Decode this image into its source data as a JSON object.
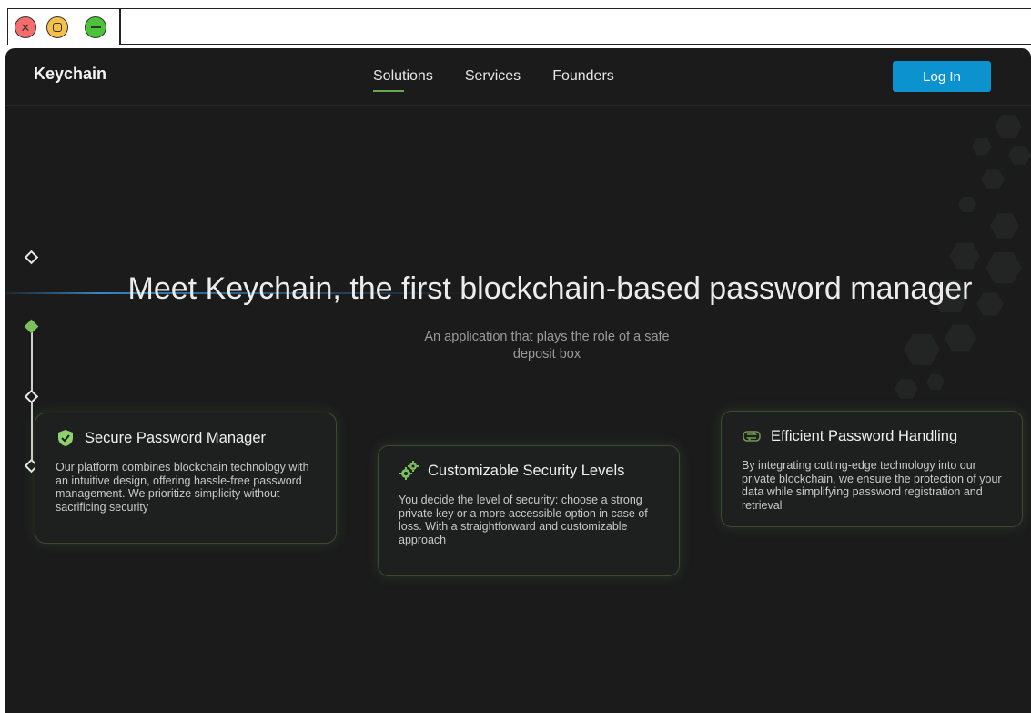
{
  "app": {
    "logo": "Keychain"
  },
  "nav": {
    "items": [
      "Solutions",
      "Services",
      "Founders"
    ]
  },
  "header": {
    "login_label": "Log In"
  },
  "hero": {
    "title": "Meet Keychain, the first blockchain-based password manager",
    "subtitle": "An application that plays the role of a safe deposit box"
  },
  "cards": [
    {
      "title": "Secure Password Manager",
      "body": "Our platform combines blockchain technology with an intuitive design, offering hassle-free password management. We prioritize simplicity without sacrificing security",
      "icon": "shield-check-icon"
    },
    {
      "title": "Customizable Security Levels",
      "body": "You decide the level of security: choose a strong private key or a more accessible option in case of loss. With a straightforward and customizable approach",
      "icon": "gears-icon"
    },
    {
      "title": "Efficient Password Handling",
      "body": "By integrating cutting-edge technology into our private blockchain, we ensure the protection of your data while simplifying password registration and retrieval",
      "icon": "exchange-icon"
    }
  ],
  "colors": {
    "accent_blue": "#0c93cf",
    "accent_green": "#7cbf5c",
    "background": "#1b1b1c"
  }
}
